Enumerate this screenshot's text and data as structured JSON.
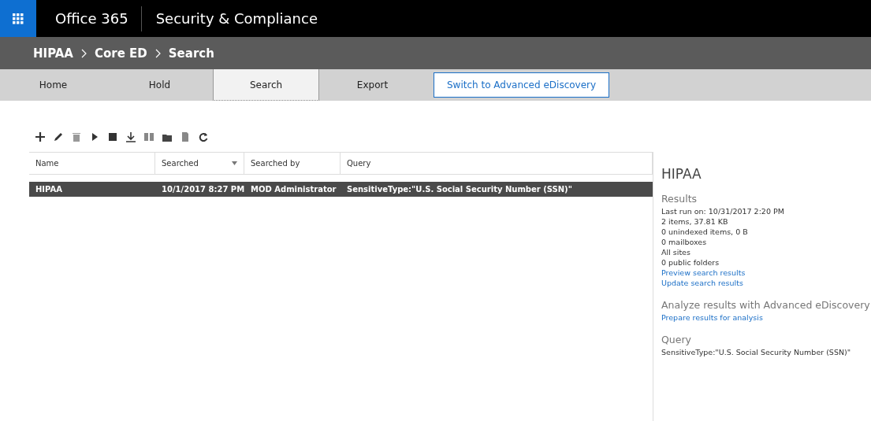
{
  "header": {
    "app": "Office 365",
    "title": "Security & Compliance"
  },
  "breadcrumb": [
    "HIPAA",
    "Core ED",
    "Search"
  ],
  "tabs": [
    {
      "label": "Home",
      "kind": "tab",
      "selected": false
    },
    {
      "label": "Hold",
      "kind": "tab",
      "selected": false
    },
    {
      "label": "Search",
      "kind": "tab",
      "selected": true
    },
    {
      "label": "Export",
      "kind": "tab",
      "selected": false
    },
    {
      "label": "Switch to Advanced eDiscovery",
      "kind": "button",
      "selected": false
    }
  ],
  "table": {
    "columns": [
      {
        "label": "Name",
        "sorted": false
      },
      {
        "label": "Searched",
        "sorted": true
      },
      {
        "label": "Searched by",
        "sorted": false
      },
      {
        "label": "Query",
        "sorted": false
      }
    ],
    "rows": [
      {
        "cells": [
          "HIPAA",
          "10/1/2017 8:27 PM",
          "MOD Administrator",
          "SensitiveType:\"U.S. Social Security Number (SSN)\""
        ],
        "selected": true
      }
    ]
  },
  "details": {
    "title": "HIPAA",
    "sections": [
      {
        "heading": "Results",
        "lines": [
          {
            "text": "Last run on: 10/31/2017 2:20 PM",
            "kind": "text"
          },
          {
            "text": "2 items, 37.81 KB",
            "kind": "text"
          },
          {
            "text": "0 unindexed items, 0 B",
            "kind": "text"
          },
          {
            "text": "0 mailboxes",
            "kind": "text"
          },
          {
            "text": "All sites",
            "kind": "text"
          },
          {
            "text": "0 public folders",
            "kind": "text"
          },
          {
            "text": "Preview search results",
            "kind": "link"
          },
          {
            "text": "Update search results",
            "kind": "link"
          }
        ]
      },
      {
        "heading": "Analyze results with Advanced eDiscovery",
        "lines": [
          {
            "text": "Prepare results for analysis",
            "kind": "link"
          }
        ]
      },
      {
        "heading": "Query",
        "lines": [
          {
            "text": "SensitiveType:\"U.S. Social Security Number (SSN)\"",
            "kind": "text"
          }
        ]
      }
    ]
  }
}
